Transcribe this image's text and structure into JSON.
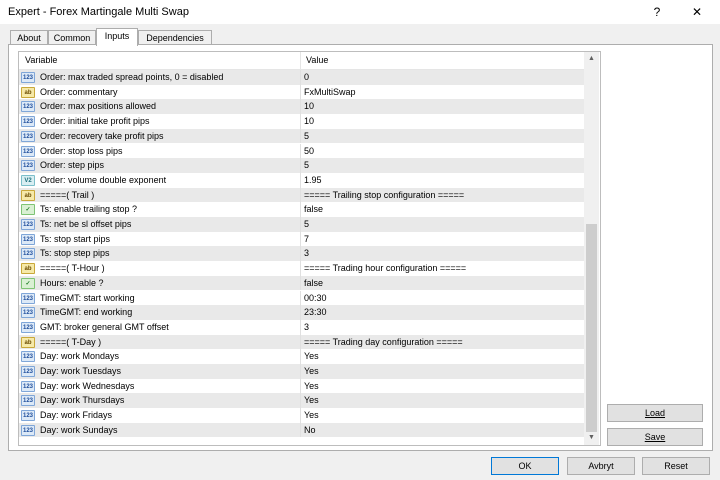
{
  "window": {
    "title": "Expert - Forex Martingale Multi Swap",
    "help_glyph": "?",
    "close_glyph": "✕"
  },
  "tabs": [
    "About",
    "Common",
    "Inputs",
    "Dependencies"
  ],
  "active_tab": "Inputs",
  "grid": {
    "col_variable": "Variable",
    "col_value": "Value",
    "rows": [
      {
        "icon": "num",
        "icon_text": "123",
        "name": "Order: max traded spread points, 0 = disabled",
        "value": "0"
      },
      {
        "icon": "str",
        "icon_text": "ab",
        "name": "Order: commentary",
        "value": "FxMultiSwap"
      },
      {
        "icon": "num",
        "icon_text": "123",
        "name": "Order: max positions allowed",
        "value": "10"
      },
      {
        "icon": "num",
        "icon_text": "123",
        "name": "Order: initial take profit pips",
        "value": "10"
      },
      {
        "icon": "num",
        "icon_text": "123",
        "name": "Order: recovery take profit pips",
        "value": "5"
      },
      {
        "icon": "num",
        "icon_text": "123",
        "name": "Order: stop loss pips",
        "value": "50"
      },
      {
        "icon": "num",
        "icon_text": "123",
        "name": "Order: step pips",
        "value": "5"
      },
      {
        "icon": "dbl",
        "icon_text": "V2",
        "name": "Order: volume double exponent",
        "value": "1.95"
      },
      {
        "icon": "str",
        "icon_text": "ab",
        "name": "=====( Trail )",
        "value": "===== Trailing stop configuration ====="
      },
      {
        "icon": "bool",
        "icon_text": "✓",
        "name": "Ts: enable trailing stop ?",
        "value": "false"
      },
      {
        "icon": "num",
        "icon_text": "123",
        "name": "Ts: net be sl offset pips",
        "value": "5"
      },
      {
        "icon": "num",
        "icon_text": "123",
        "name": "Ts: stop start pips",
        "value": "7"
      },
      {
        "icon": "num",
        "icon_text": "123",
        "name": "Ts: stop step pips",
        "value": "3"
      },
      {
        "icon": "str",
        "icon_text": "ab",
        "name": "=====( T-Hour )",
        "value": "===== Trading hour configuration ====="
      },
      {
        "icon": "bool",
        "icon_text": "✓",
        "name": "Hours: enable ?",
        "value": "false"
      },
      {
        "icon": "num",
        "icon_text": "123",
        "name": "TimeGMT: start working",
        "value": "00:30"
      },
      {
        "icon": "num",
        "icon_text": "123",
        "name": "TimeGMT: end working",
        "value": "23:30"
      },
      {
        "icon": "num",
        "icon_text": "123",
        "name": "GMT: broker general GMT offset",
        "value": "3"
      },
      {
        "icon": "str",
        "icon_text": "ab",
        "name": "=====( T-Day )",
        "value": "===== Trading day configuration ====="
      },
      {
        "icon": "num",
        "icon_text": "123",
        "name": "Day: work Mondays",
        "value": "Yes"
      },
      {
        "icon": "num",
        "icon_text": "123",
        "name": "Day: work Tuesdays",
        "value": "Yes"
      },
      {
        "icon": "num",
        "icon_text": "123",
        "name": "Day: work Wednesdays",
        "value": "Yes"
      },
      {
        "icon": "num",
        "icon_text": "123",
        "name": "Day: work Thursdays",
        "value": "Yes"
      },
      {
        "icon": "num",
        "icon_text": "123",
        "name": "Day: work Fridays",
        "value": "Yes"
      },
      {
        "icon": "num",
        "icon_text": "123",
        "name": "Day: work Sundays",
        "value": "No"
      }
    ]
  },
  "buttons": {
    "load": "Load",
    "save": "Save",
    "ok": "OK",
    "cancel": "Avbryt",
    "reset": "Reset"
  },
  "scroll": {
    "up": "▲",
    "down": "▼"
  }
}
